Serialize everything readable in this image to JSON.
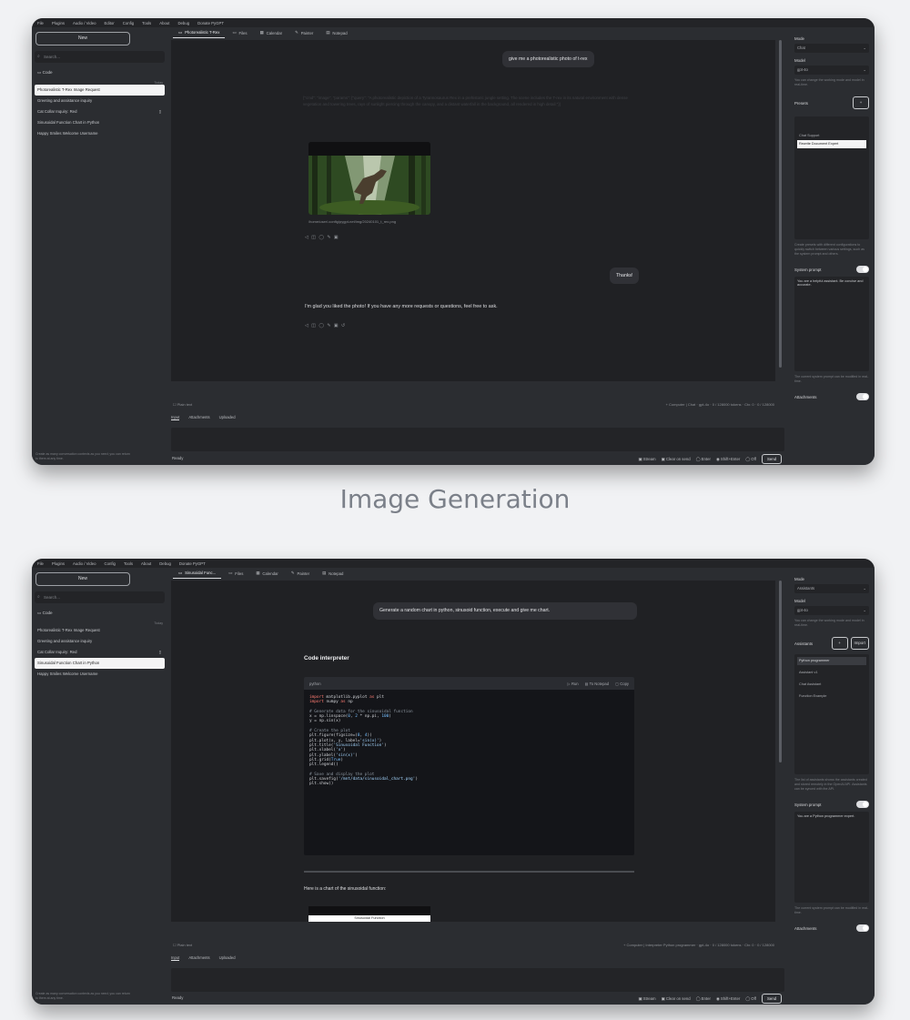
{
  "caption": "Image Generation",
  "menu": [
    "File",
    "Plugins",
    "Audio / Video",
    "Editor",
    "Config",
    "Tools",
    "About",
    "Debug",
    "Donate PyGPT"
  ],
  "shot1": {
    "sidebar": {
      "new_label": "New",
      "search_placeholder": "Search...",
      "folder": "Code",
      "folder_meta": "Today",
      "items": [
        "Photorealistic T-Rex Image Request",
        "Greeting and assistance inquiry",
        "Cat Collar Inquiry: Red",
        "Sinusoidal Function Chart in Python",
        "Happy Smiles Welcome Username"
      ],
      "active_index": 0,
      "footer": "Create as many conversation contexts as you need; you can return to them at any time."
    },
    "tabs": [
      "Photorealistic T-Rex",
      "Files",
      "Calendar",
      "Painter",
      "Notepad"
    ],
    "chat": {
      "user_message": "give me a photorealistic photo of t-rex",
      "faint_text": "{\"cmd\": \"image\", \"params\": {\"query\": \"A photorealistic depiction of a Tyrannosaurus Rex in a prehistoric jungle setting. The scene includes the T-rex in its natural environment with dense vegetation and towering trees, rays of sunlight piercing through the canopy, and a distant waterfall in the background, all rendered in high detail.\"}}",
      "image_caption": "/home/user/.config/pygpt-net/img/20240101_t_rex.png",
      "actions1": "◁ ◫ ◯ ✎ ▣",
      "user_message2": "Thanks!",
      "reply": "I'm glad you liked the photo! If you have any more requests or questions, feel free to ask.",
      "actions2": "◁ ◫ ◯ ✎ ▣ ↺"
    },
    "status_left": "Plain text",
    "status_right": "+ Computer | Chat · gpt-4o · 0 / 128000 tokens · Ctx: 0 · 0 / 128000",
    "bottom_tabs": [
      "Input",
      "Attachments",
      "Uploaded"
    ],
    "ready": "Ready",
    "options": [
      "Stream",
      "Clear on send",
      "Enter",
      "Shift+Enter",
      "Off"
    ],
    "send": "Send",
    "right": {
      "mode_label": "Mode",
      "mode_value": "Chat",
      "model_label": "Model",
      "model_value": "gpt-4o",
      "model_note": "You can change the working mode and model in real-time.",
      "presets_label": "Presets",
      "presets": [
        "Chat Support",
        "Rewrite Document Expert"
      ],
      "preset_selected": 1,
      "presets_note": "Create presets with different configurations to quickly switch between various settings, such as the system prompt and others.",
      "system_label": "System prompt",
      "system_text": "You are a helpful assistant. Be concise and accurate.",
      "system_note": "The current system prompt can be modified in real-time.",
      "attachments_label": "Attachments"
    }
  },
  "shot2": {
    "sidebar": {
      "new_label": "New",
      "search_placeholder": "Search...",
      "folder": "Code",
      "folder_meta": "Today",
      "items": [
        "Photorealistic T-Rex Image Request",
        "Greeting and assistance inquiry",
        "Cat Collar Inquiry: Red",
        "Sinusoidal Function Chart in Python",
        "Happy Smiles Welcome Username"
      ],
      "active_index": 3,
      "footer": "Create as many conversation contexts as you need; you can return to them at any time."
    },
    "tabs": [
      "Sinusoidal Func...",
      "Files",
      "Calendar",
      "Painter",
      "Notepad"
    ],
    "chat": {
      "user_message": "Generate a random chart in python, sinusoid function, execute and give me chart.",
      "heading": "Code interpreter",
      "code_lang": "python",
      "code_actions": [
        "Run",
        "To Notepad",
        "Copy"
      ],
      "after_code": "Here is a chart of the sinusoidal function: ",
      "chart_title": "Sinusoidal Function"
    },
    "status_left": "Plain text",
    "status_right": "+ Computer | Interpreter Python programmer · gpt-4o · 0 / 128000 tokens · Ctx: 0 · 0 / 128000",
    "bottom_tabs": [
      "Input",
      "Attachments",
      "Uploaded"
    ],
    "ready": "Ready",
    "options": [
      "Stream",
      "Clear on send",
      "Enter",
      "Shift+Enter",
      "Off"
    ],
    "send": "Send",
    "right": {
      "mode_label": "Mode",
      "mode_value": "Assistants",
      "model_label": "Model",
      "model_value": "gpt-4o",
      "model_note": "You can change the working mode and model in real-time.",
      "assistants_label": "Assistants",
      "import_label": "Import",
      "assistants": [
        "Python programmer",
        "Assistant v1",
        "Chat Assistant",
        "Function Example"
      ],
      "assistant_selected": 0,
      "assistants_note": "The list of assistants shows the assistants created and stored remotely in the OpenAI API. Assistants can be synced with the API.",
      "system_label": "System prompt",
      "system_text": "You are a Python programmer expert.",
      "system_note": "The current system prompt can be modified in real-time.",
      "attachments_label": "Attachments"
    }
  }
}
